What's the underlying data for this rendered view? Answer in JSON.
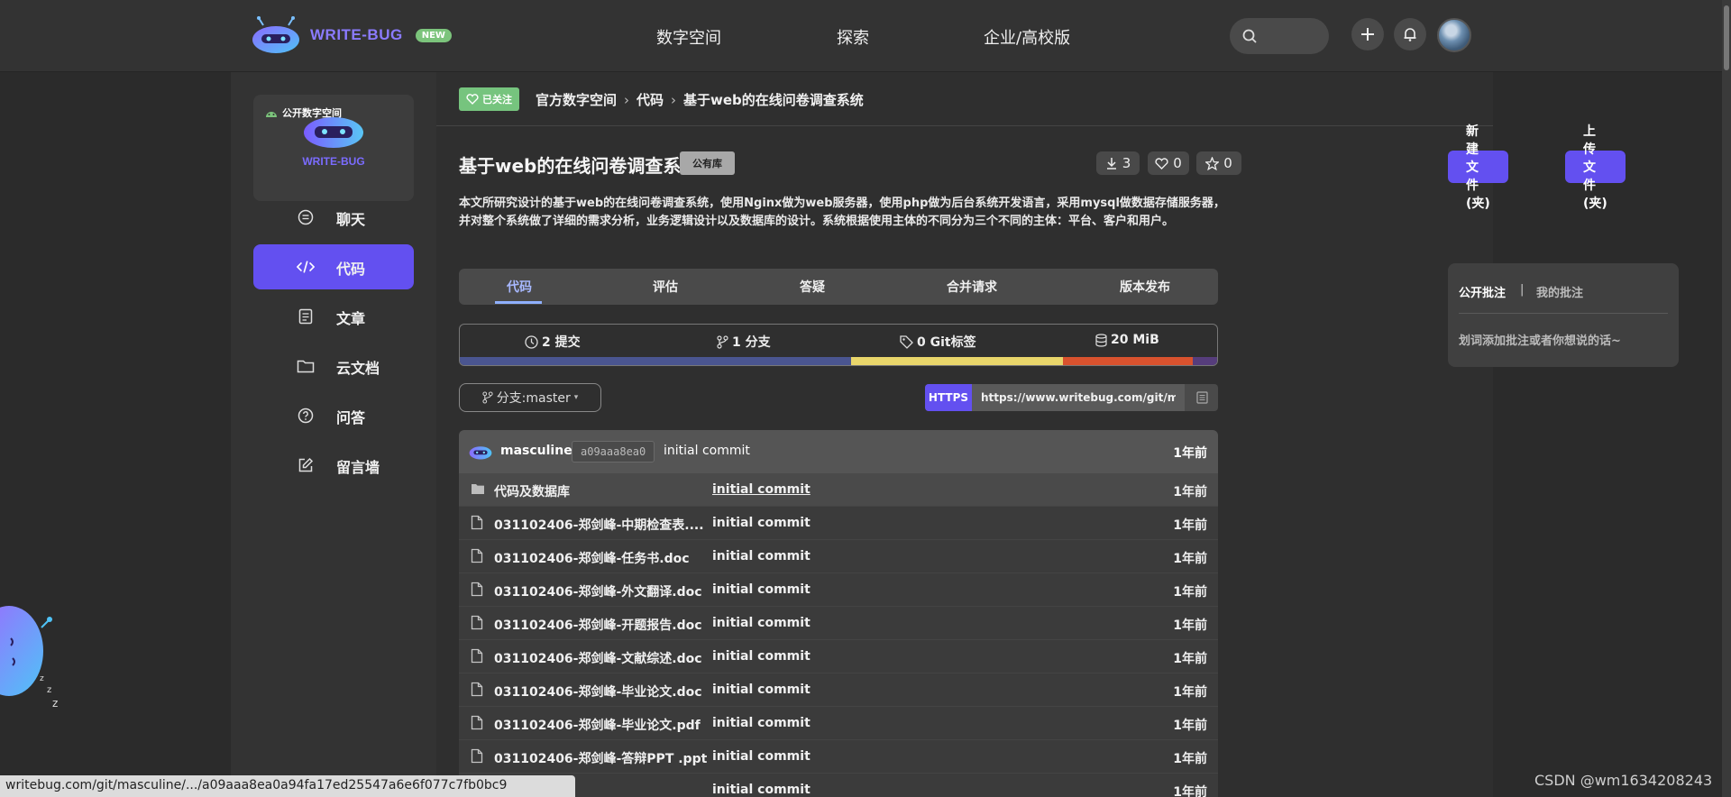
{
  "header": {
    "logo_text": "WRITE-BUG",
    "new_badge": "NEW",
    "nav": [
      "数字空间",
      "探索",
      "企业/高校版"
    ]
  },
  "sidebar": {
    "space_tag": "公开数字空间",
    "space_name": "WRITE-BUG",
    "items": [
      {
        "label": "聊天",
        "icon": "chat-icon"
      },
      {
        "label": "代码",
        "icon": "code-icon"
      },
      {
        "label": "文章",
        "icon": "document-icon"
      },
      {
        "label": "云文档",
        "icon": "folder-icon"
      },
      {
        "label": "问答",
        "icon": "question-icon"
      },
      {
        "label": "留言墙",
        "icon": "edit-icon"
      }
    ],
    "active_index": 1
  },
  "breadcrumb": {
    "follow_label": "已关注",
    "items": [
      "官方数字空间",
      "代码",
      "基于web的在线问卷调查系统"
    ]
  },
  "repo": {
    "title": "基于web的在线问卷调查系统",
    "visibility": "公有库",
    "downloads": "3",
    "likes": "0",
    "stars": "0",
    "new_file_label": "新建文件(夹)",
    "upload_label": "上传文件(夹)",
    "description": "本文所研究设计的基于web的在线问卷调查系统，使用Nginx做为web服务器，使用php做为后台系统开发语言，采用mysql做数据存储服务器，并对整个系统做了详细的需求分析，业务逻辑设计以及数据库的设计。系统根据使用主体的不同分为三个不同的主体：平台、客户和用户。"
  },
  "tabs": [
    "代码",
    "评估",
    "答疑",
    "合并请求",
    "版本发布"
  ],
  "stats": {
    "commits": "2 提交",
    "branches": "1 分支",
    "tags": "0 Git标签",
    "size": "20 MiB"
  },
  "lang_bar": [
    {
      "color": "#4a5590",
      "percent": 51.5
    },
    {
      "color": "#e9d66b",
      "percent": 28
    },
    {
      "color": "#d9522e",
      "percent": 17
    },
    {
      "color": "#563d7c",
      "percent": 3.5
    }
  ],
  "branch_label": "分支:master",
  "clone": {
    "protocol": "HTTPS",
    "url": "https://www.writebug.com/git/masculine/"
  },
  "commit": {
    "user": "masculine",
    "hash": "a09aaa8ea0",
    "message": "initial commit",
    "time": "1年前"
  },
  "files": [
    {
      "name": "代码及数据库",
      "type": "folder",
      "message": "initial commit",
      "time": "1年前"
    },
    {
      "name": "031102406-郑剑峰-中期检查表....",
      "type": "file",
      "message": "initial commit",
      "time": "1年前"
    },
    {
      "name": "031102406-郑剑峰-任务书.doc",
      "type": "file",
      "message": "initial commit",
      "time": "1年前"
    },
    {
      "name": "031102406-郑剑峰-外文翻译.doc",
      "type": "file",
      "message": "initial commit",
      "time": "1年前"
    },
    {
      "name": "031102406-郑剑峰-开题报告.doc",
      "type": "file",
      "message": "initial commit",
      "time": "1年前"
    },
    {
      "name": "031102406-郑剑峰-文献综述.doc",
      "type": "file",
      "message": "initial commit",
      "time": "1年前"
    },
    {
      "name": "031102406-郑剑峰-毕业论文.doc",
      "type": "file",
      "message": "initial commit",
      "time": "1年前"
    },
    {
      "name": "031102406-郑剑峰-毕业论文.pdf",
      "type": "file",
      "message": "initial commit",
      "time": "1年前"
    },
    {
      "name": "031102406-郑剑峰-答辩PPT .ppt",
      "type": "file",
      "message": "initial commit",
      "time": "1年前"
    },
    {
      "name": "",
      "type": "file",
      "message": "initial commit",
      "time": "1年前"
    }
  ],
  "notes": {
    "public_tab": "公开批注",
    "separator": "|",
    "mine_tab": "我的批注",
    "hint": "划词添加批注或者你想说的话~"
  },
  "status_url": "writebug.com/git/masculine/.../a09aaa8ea0a94fa17ed25547a6e6f077c7fb0bc9",
  "watermark": "CSDN @wm1634208243"
}
